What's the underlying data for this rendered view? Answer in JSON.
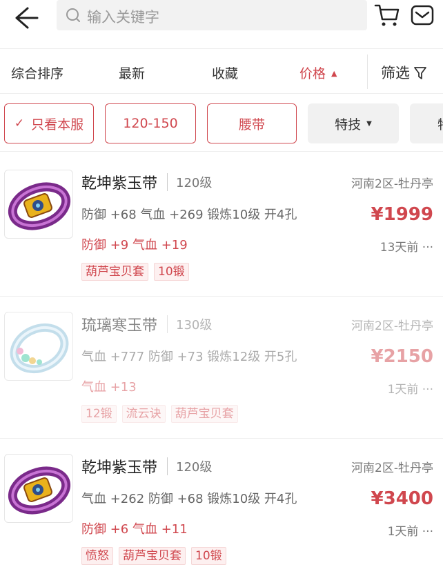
{
  "header": {
    "search_placeholder": "输入关键字",
    "icons": [
      "back-arrow-icon",
      "search-icon",
      "cart-icon",
      "message-icon"
    ]
  },
  "sortbar": {
    "items": [
      {
        "label": "综合排序"
      },
      {
        "label": "最新"
      },
      {
        "label": "收藏"
      },
      {
        "label": "价格",
        "active": true
      }
    ],
    "filter_label": "筛选"
  },
  "chips": [
    {
      "label": "只看本服",
      "checked": true
    },
    {
      "label": "120-150"
    },
    {
      "label": "腰带"
    },
    {
      "label": "特技"
    },
    {
      "label": "特"
    }
  ],
  "colors": {
    "accent": "#d0474e",
    "text": "#333333",
    "muted": "#777777"
  },
  "items": [
    {
      "name": "乾坤紫玉带",
      "level": "120级",
      "server": "河南2区-牡丹亭",
      "stats": "防御 +68 气血 +269 锻炼10级 开4孔",
      "price": "¥1999",
      "bonus": "防御 +9 气血 +19",
      "time": "13天前 ···",
      "tags": [
        "葫芦宝贝套",
        "10锻"
      ],
      "faded": false
    },
    {
      "name": "琉璃寒玉带",
      "level": "130级",
      "server": "河南2区-牡丹亭",
      "stats": "气血 +777 防御 +73 锻炼12级 开5孔",
      "price": "¥2150",
      "bonus": "气血 +13",
      "time": "1天前 ···",
      "tags": [
        "12锻",
        "流云诀",
        "葫芦宝贝套"
      ],
      "faded": true
    },
    {
      "name": "乾坤紫玉带",
      "level": "120级",
      "server": "河南2区-牡丹亭",
      "stats": "气血 +262 防御 +68 锻炼10级 开4孔",
      "price": "¥3400",
      "bonus": "防御 +6 气血 +11",
      "time": "1天前 ···",
      "tags": [
        "愤怒",
        "葫芦宝贝套",
        "10锻"
      ],
      "faded": false
    }
  ]
}
